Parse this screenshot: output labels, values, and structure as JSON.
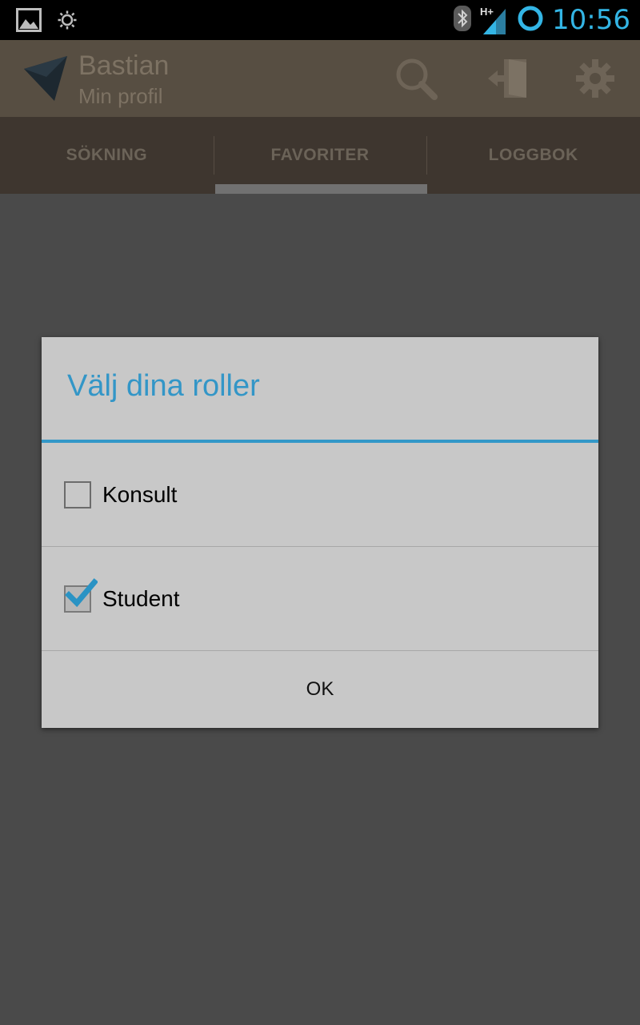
{
  "status_bar": {
    "time": "10:56",
    "network_label": "H+",
    "icons": [
      "image-icon",
      "brightness-icon",
      "bluetooth-icon",
      "signal-icon",
      "sync-circle-icon"
    ]
  },
  "action_bar": {
    "title": "Bastian",
    "subtitle": "Min profil",
    "icons": [
      "app-logo-icon",
      "search-icon",
      "logout-icon",
      "gear-icon"
    ]
  },
  "tabs": [
    {
      "label": "SÖKNING"
    },
    {
      "label": "FAVORITER",
      "selected": true
    },
    {
      "label": "LOGGBOK"
    }
  ],
  "dialog": {
    "title": "Välj dina roller",
    "options": [
      {
        "label": "Konsult",
        "checked": false
      },
      {
        "label": "Student",
        "checked": true
      }
    ],
    "ok_label": "OK"
  },
  "colors": {
    "accent": "#33b5e5",
    "dialog_title": "#3396c7",
    "action_bar": "#574e42",
    "tab_bar": "#3e362f",
    "scrim": "#4a4a4a"
  }
}
